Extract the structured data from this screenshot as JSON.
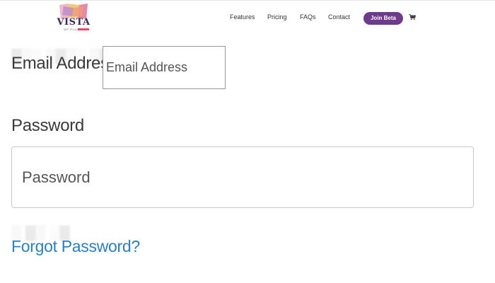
{
  "header": {
    "logo": {
      "name": "VISTA",
      "tagline": "WP PLUGIN"
    },
    "nav": {
      "features": "Features",
      "pricing": "Pricing",
      "faqs": "FAQs",
      "contact": "Contact"
    },
    "cta": "Join Beta",
    "cart_icon": "shopping-cart-icon"
  },
  "form": {
    "email": {
      "label": "Email Address",
      "placeholder": "Email Address",
      "value": ""
    },
    "password": {
      "label": "Password",
      "placeholder": "Password",
      "value": ""
    },
    "forgot_link": "Forgot Password?"
  },
  "colors": {
    "cta_bg": "#6e3a8a",
    "link": "#2a7fbf",
    "text": "#3a3a3a"
  }
}
